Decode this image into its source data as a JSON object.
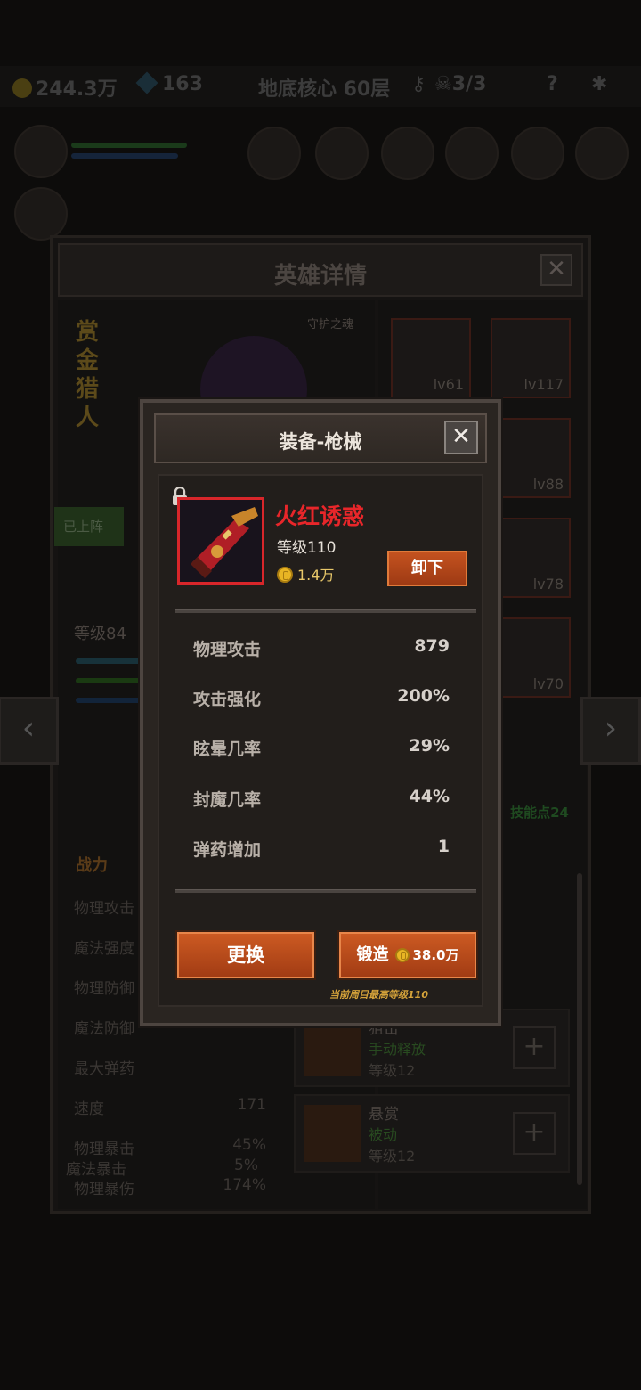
{
  "topbar": {
    "gold": "244.3万",
    "gems": "163",
    "floor": "地底核心 60层",
    "skulls": "3/3",
    "help": "?"
  },
  "hero_panel": {
    "title": "英雄详情",
    "close": "✕",
    "hero_name": "赏金猎人",
    "guardian": "守护之魂",
    "deployed": "已上阵",
    "level": "等级84",
    "equip_slots": [
      {
        "level": "lv61"
      },
      {
        "level": "lv117"
      },
      {
        "level": "lv88"
      },
      {
        "level": "lv78"
      },
      {
        "level": "lv70"
      }
    ],
    "skill_points": "技能点24",
    "power_label": "战力",
    "stats": [
      {
        "label": "物理攻击",
        "value": ""
      },
      {
        "label": "魔法强度",
        "value": ""
      },
      {
        "label": "物理防御",
        "value": ""
      },
      {
        "label": "魔法防御",
        "value": ""
      },
      {
        "label": "最大弹药",
        "value": ""
      },
      {
        "label": "速度",
        "value": "171"
      },
      {
        "label": "物理暴击",
        "value": "45%"
      },
      {
        "label": "物理暴伤",
        "value": "174%"
      },
      {
        "label": "魔法暴击",
        "value": "5%"
      }
    ],
    "skills": [
      {
        "name": "狙击",
        "type": "手动释放",
        "level": "等级12"
      },
      {
        "name": "悬赏",
        "type": "被动",
        "level": "等级12"
      }
    ],
    "plus": "+",
    "prev": "‹",
    "next": "›"
  },
  "modal": {
    "title": "装备-枪械",
    "close": "✕",
    "item": {
      "name": "火红诱惑",
      "level": "等级110",
      "price": "1.4万"
    },
    "unequip": "卸下",
    "stats": [
      {
        "label": "物理攻击",
        "value": "879"
      },
      {
        "label": "攻击强化",
        "value": "200%"
      },
      {
        "label": "眩晕几率",
        "value": "29%"
      },
      {
        "label": "封魔几率",
        "value": "44%"
      },
      {
        "label": "弹药增加",
        "value": "1"
      }
    ],
    "change": "更换",
    "forge": "锻造",
    "forge_cost": "38.0万",
    "max_level_note": "当前周目最高等级110"
  },
  "colors": {
    "item_frame": "#d8262a",
    "button_orange": "#c4521f",
    "note_gold": "#d4a23a"
  }
}
